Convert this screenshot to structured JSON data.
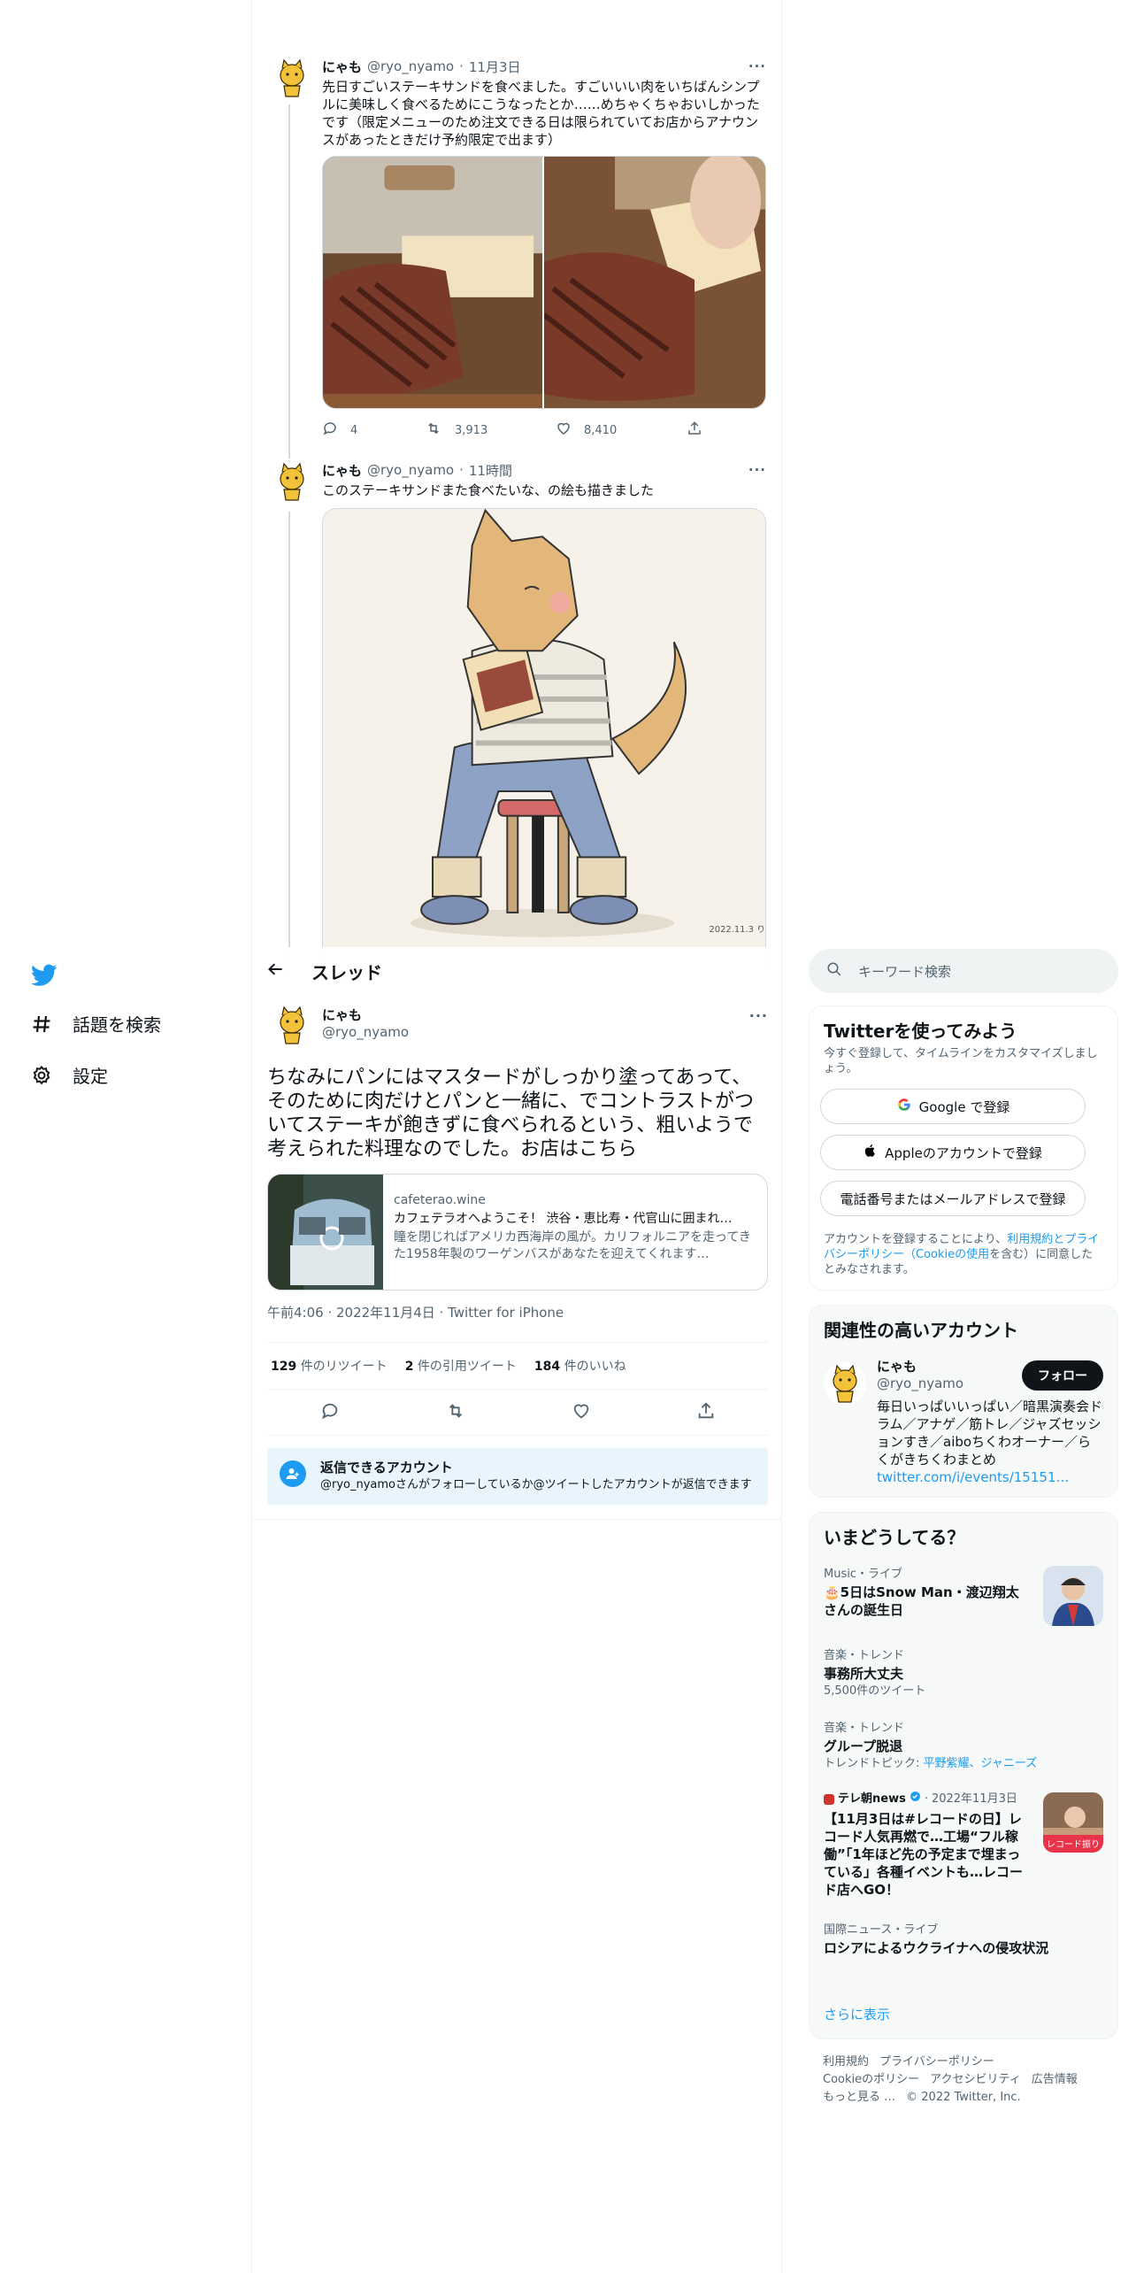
{
  "nav": {
    "items": [
      {
        "label": "話題を検索",
        "icon": "hashtag-icon"
      },
      {
        "label": "設定",
        "icon": "gear-icon"
      }
    ]
  },
  "thread": {
    "header_title": "スレッド",
    "tweets": [
      {
        "name": "にゃも",
        "handle": "@ryo_nyamo",
        "date": "11月3日",
        "text": "先日すごいステーキサンドを食べました。すごいいい肉をいちばんシンプルに美味しく食べるためにこうなったとか……めちゃくちゃおいしかったです（限定メニューのため注文できる日は限られていてお店からアナウンスがあったときだけ予約限定で出ます）",
        "replies": "4",
        "retweets": "3,913",
        "likes": "8,410"
      },
      {
        "name": "にゃも",
        "handle": "@ryo_nyamo",
        "date": "11時間",
        "text": "このステーキサンドまた食べたいな、の絵も描きました",
        "signature": "2022.11.3 りにゃも"
      }
    ],
    "focus": {
      "name": "にゃも",
      "handle": "@ryo_nyamo",
      "text": "ちなみにパンにはマスタードがしっかり塗ってあって、そのために肉だけとパンと一緒に、でコントラストがついてステーキが飽きずに食べられるという、粗いようで考えられた料理なのでした。お店はこちら",
      "card": {
        "domain": "cafeterao.wine",
        "title": "カフェテラオへようこそ！ 渋谷・恵比寿・代官山に囲まれ…",
        "desc": "瞳を閉じればアメリカ西海岸の風が。カリフォルニアを走ってきた1958年製のワーゲンバスがあなたを迎えてくれます…"
      },
      "meta": "午前4:06 · 2022年11月4日 · Twitter for iPhone",
      "stats": [
        {
          "num": "129",
          "label": "件のリツイート"
        },
        {
          "num": "2",
          "label": "件の引用ツイート"
        },
        {
          "num": "184",
          "label": "件のいいね"
        }
      ],
      "reply_restrict_title": "返信できるアカウント",
      "reply_restrict_text": "@ryo_nyamoさんがフォローしているか@ツイートしたアカウントが返信できます"
    }
  },
  "sidebar": {
    "search_placeholder": "キーワード検索",
    "signup": {
      "title": "Twitterを使ってみよう",
      "subtitle": "今すぐ登録して、タイムラインをカスタマイズしましょう。",
      "google": "Google で登録",
      "apple": "Appleのアカウントで登録",
      "phone": "電話番号またはメールアドレスで登録",
      "legal_1": "アカウントを登録することにより、",
      "legal_link": "利用規約とプライバシーポリシー（Cookieの使用",
      "legal_2": "を含む）に同意したとみなされます。"
    },
    "related": {
      "title": "関連性の高いアカウント",
      "name": "にゃも",
      "handle": "@ryo_nyamo",
      "follow": "フォロー",
      "bio": "毎日いっぱいいっぱい／暗黒演奏会ドラム／アナゲ／筋トレ／ジャズセッションすき／aiboちくわオーナー／らくがきちくわまとめ",
      "bio_link": "twitter.com/i/events/15151…"
    },
    "trends": {
      "title": "いまどうしてる？",
      "items": [
        {
          "cat": "Music・ライブ",
          "title": "🎂5日はSnow Man・渡辺翔太さんの誕生日"
        },
        {
          "cat": "音楽・トレンド",
          "title": "事務所大丈夫",
          "sub": "5,500件のツイート"
        },
        {
          "cat": "音楽・トレンド",
          "title": "グループ脱退",
          "sub_prefix": "トレンドトピック: ",
          "sub_link": "平野紫耀、ジャニーズ"
        },
        {
          "source": "テレ朝news",
          "date": "2022年11月3日",
          "title": "【11月3日は#レコードの日】レコード人気再燃で…工場“フル稼働”「1年ほど先の予定まで埋まっている」各種イベントも…レコード店へGO！",
          "img_text": "レコード振り"
        },
        {
          "cat": "国際ニュース・ライブ",
          "title": "ロシアによるウクライナへの侵攻状況"
        }
      ],
      "show_more": "さらに表示"
    },
    "footer": [
      "利用規約",
      "プライバシーポリシー",
      "Cookieのポリシー",
      "アクセシビリティ",
      "広告情報",
      "もっと見る …",
      "© 2022 Twitter, Inc."
    ]
  },
  "colors": {
    "accent": "#1d9bf0",
    "text": "#0f1419",
    "muted": "#536471"
  }
}
